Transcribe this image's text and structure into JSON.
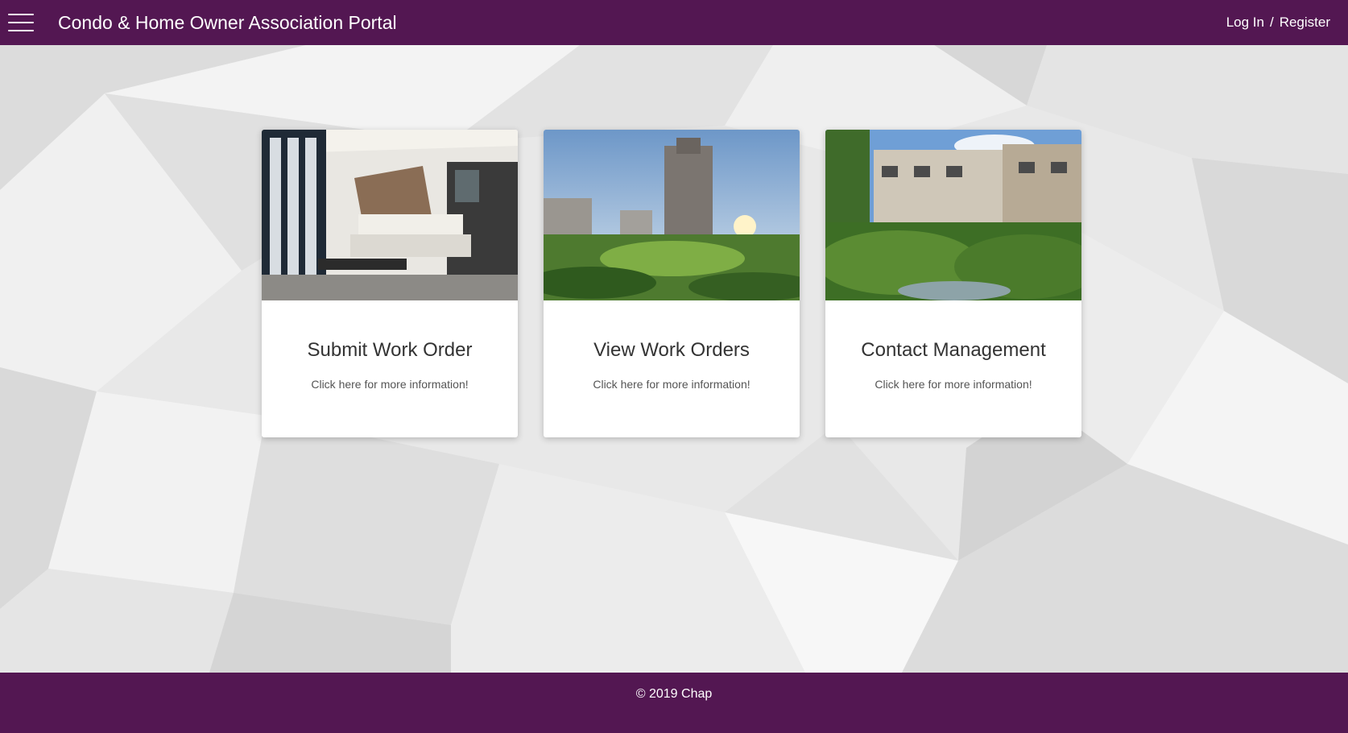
{
  "header": {
    "title": "Condo & Home Owner Association Portal",
    "login_label": "Log In",
    "separator": "/",
    "register_label": "Register"
  },
  "cards": [
    {
      "title": "Submit Work Order",
      "subtitle": "Click here for more information!"
    },
    {
      "title": "View Work Orders",
      "subtitle": "Click here for more information!"
    },
    {
      "title": "Contact Management",
      "subtitle": "Click here for more information!"
    }
  ],
  "footer": {
    "copyright": "© 2019 Chap"
  },
  "colors": {
    "brand": "#531752",
    "background": "#e9e9e9"
  }
}
